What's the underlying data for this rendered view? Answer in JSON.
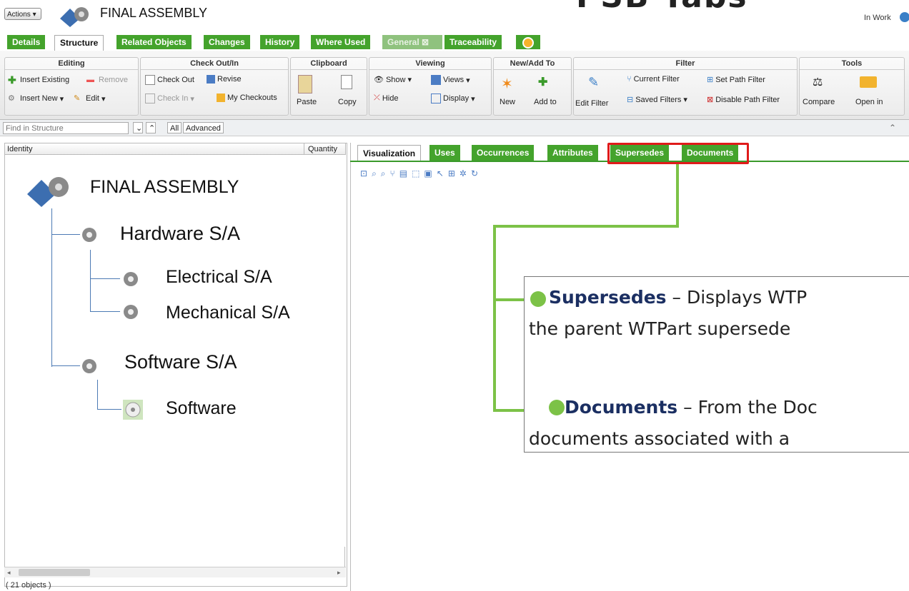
{
  "header": {
    "actions_label": "Actions",
    "title": "FINAL ASSEMBLY",
    "overlay_title": "PSB Tabs",
    "status": "In Work"
  },
  "tabs": [
    "Details",
    "Structure",
    "Related Objects",
    "Changes",
    "History",
    "Where Used",
    "General",
    "Traceability"
  ],
  "ribbon": {
    "editing": {
      "title": "Editing",
      "insert_existing": "Insert Existing",
      "remove": "Remove",
      "insert_new": "Insert New",
      "edit": "Edit"
    },
    "checkout": {
      "title": "Check Out/In",
      "check_out": "Check Out",
      "revise": "Revise",
      "check_in": "Check In",
      "my_checkouts": "My Checkouts"
    },
    "clipboard": {
      "title": "Clipboard",
      "paste": "Paste",
      "copy": "Copy"
    },
    "viewing": {
      "title": "Viewing",
      "show": "Show",
      "views": "Views",
      "hide": "Hide",
      "display": "Display"
    },
    "newadd": {
      "title": "New/Add To",
      "new": "New",
      "add_to": "Add to"
    },
    "filter": {
      "title": "Filter",
      "edit_filter": "Edit Filter",
      "current_filter": "Current Filter",
      "set_path_filter": "Set Path Filter",
      "saved_filters": "Saved Filters",
      "disable_path_filter": "Disable Path Filter"
    },
    "tools": {
      "title": "Tools",
      "compare": "Compare",
      "open_in": "Open in"
    }
  },
  "findbar": {
    "placeholder": "Find in Structure",
    "all": "All",
    "advanced": "Advanced"
  },
  "tree": {
    "col_identity": "Identity",
    "col_quantity": "Quantity",
    "nodes": [
      "FINAL ASSEMBLY",
      "Hardware S/A",
      "Electrical S/A",
      "Mechanical S/A",
      "Software S/A",
      "Software"
    ],
    "count": "( 21 objects )"
  },
  "right_tabs": [
    "Visualization",
    "Uses",
    "Occurrences",
    "Attributes",
    "Supersedes",
    "Documents"
  ],
  "callout": {
    "line1_bold": "Supersedes",
    "line1_rest": " – Displays WTP",
    "line2": "the parent WTPart supersede",
    "line3_bold": "Documents",
    "line3_rest": " – From the Doc",
    "line4": "documents associated with a"
  },
  "colors": {
    "tab_green": "#44a32c",
    "highlight_red": "#e01a1a",
    "callout_green": "#7cc247",
    "callout_bold": "#1b2f62"
  }
}
